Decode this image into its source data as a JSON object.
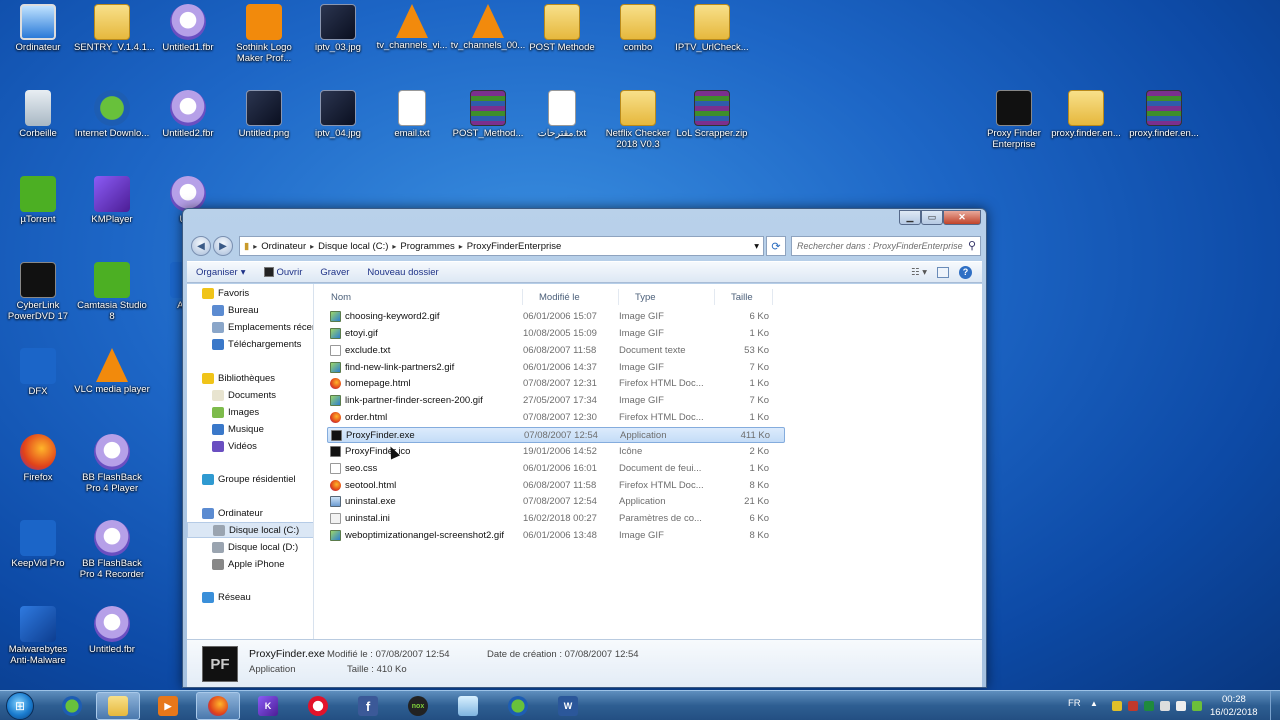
{
  "desktop": {
    "icons": [
      {
        "label": "Ordinateur",
        "icon": "computer-icon"
      },
      {
        "label": "SENTRY_V.1.4.1...",
        "icon": "folder-icon"
      },
      {
        "label": "Untitled1.fbr",
        "icon": "flashback-recording-icon"
      },
      {
        "label": "Sothink Logo Maker Prof...",
        "icon": "sothink-logo-maker-icon"
      },
      {
        "label": "iptv_03.jpg",
        "icon": "image-file-icon"
      },
      {
        "label": "tv_channels_vi...",
        "icon": "vlc-playlist-icon"
      },
      {
        "label": "tv_channels_00...",
        "icon": "vlc-playlist-icon"
      },
      {
        "label": "POST Methode",
        "icon": "folder-icon"
      },
      {
        "label": "combo",
        "icon": "folder-icon"
      },
      {
        "label": "IPTV_UrlCheck...",
        "icon": "folder-icon"
      },
      {
        "label": "Corbeille",
        "icon": "recycle-bin-icon"
      },
      {
        "label": "Internet Downlo...",
        "icon": "internet-download-manager-icon"
      },
      {
        "label": "Untitled2.fbr",
        "icon": "flashback-recording-icon"
      },
      {
        "label": "Untitled.png",
        "icon": "image-file-icon"
      },
      {
        "label": "iptv_04.jpg",
        "icon": "image-file-icon"
      },
      {
        "label": "email.txt",
        "icon": "text-file-icon"
      },
      {
        "label": "POST_Method...",
        "icon": "archive-file-icon"
      },
      {
        "label": "مقترحات.txt",
        "icon": "text-file-icon"
      },
      {
        "label": "Netflix Checker 2018 V0.3",
        "icon": "folder-icon"
      },
      {
        "label": "LoL Scrapper.zip",
        "icon": "archive-file-icon"
      },
      {
        "label": "Proxy Finder Enterprise",
        "icon": "proxy-finder-icon"
      },
      {
        "label": "proxy.finder.en...",
        "icon": "folder-icon"
      },
      {
        "label": "proxy.finder.en...",
        "icon": "archive-file-icon"
      },
      {
        "label": "µTorrent",
        "icon": "utorrent-icon"
      },
      {
        "label": "KMPlayer",
        "icon": "kmplayer-icon"
      },
      {
        "label": "Unti",
        "icon": "flashback-recording-icon"
      },
      {
        "label": "CyberLink PowerDVD 17",
        "icon": "powerdvd-icon"
      },
      {
        "label": "Camtasia Studio 8",
        "icon": "camtasia-icon"
      },
      {
        "label": "AL M",
        "icon": "app-icon"
      },
      {
        "label": "DFX",
        "icon": "dfx-icon"
      },
      {
        "label": "VLC media player",
        "icon": "vlc-icon"
      },
      {
        "label": "Firefox",
        "icon": "firefox-icon"
      },
      {
        "label": "BB FlashBack Pro 4 Player",
        "icon": "flashback-player-icon"
      },
      {
        "label": "KeepVid Pro",
        "icon": "keepvid-icon"
      },
      {
        "label": "BB FlashBack Pro 4 Recorder",
        "icon": "flashback-recorder-icon"
      },
      {
        "label": "Malwarebytes Anti-Malware",
        "icon": "malwarebytes-icon"
      },
      {
        "label": "Untitled.fbr",
        "icon": "flashback-recording-icon"
      }
    ]
  },
  "explorer": {
    "breadcrumb": [
      "Ordinateur",
      "Disque local (C:)",
      "Programmes",
      "ProxyFinderEnterprise"
    ],
    "search_placeholder": "Rechercher dans : ProxyFinderEnterprise",
    "toolbar": {
      "organize": "Organiser",
      "open": "Ouvrir",
      "burn": "Graver",
      "new_folder": "Nouveau dossier"
    },
    "nav": [
      {
        "label": "Favoris",
        "icon": "star-icon"
      },
      {
        "label": "Bureau",
        "icon": "desktop-icon"
      },
      {
        "label": "Emplacements récen",
        "icon": "recent-places-icon"
      },
      {
        "label": "Téléchargements",
        "icon": "downloads-icon"
      },
      {
        "label": "Bibliothèques",
        "icon": "libraries-icon"
      },
      {
        "label": "Documents",
        "icon": "documents-icon"
      },
      {
        "label": "Images",
        "icon": "pictures-icon"
      },
      {
        "label": "Musique",
        "icon": "music-icon"
      },
      {
        "label": "Vidéos",
        "icon": "videos-icon"
      },
      {
        "label": "Groupe résidentiel",
        "icon": "homegroup-icon"
      },
      {
        "label": "Ordinateur",
        "icon": "computer-icon"
      },
      {
        "label": "Disque local (C:)",
        "icon": "drive-icon"
      },
      {
        "label": "Disque local (D:)",
        "icon": "drive-icon"
      },
      {
        "label": "Apple iPhone",
        "icon": "iphone-icon"
      },
      {
        "label": "Réseau",
        "icon": "network-icon"
      }
    ],
    "columns": {
      "name": "Nom",
      "modified": "Modifié le",
      "type": "Type",
      "size": "Taille"
    },
    "files": [
      {
        "name": "choosing-keyword2.gif",
        "modified": "06/01/2006 15:07",
        "type": "Image GIF",
        "size": "6 Ko"
      },
      {
        "name": "etoyi.gif",
        "modified": "10/08/2005 15:09",
        "type": "Image GIF",
        "size": "1 Ko"
      },
      {
        "name": "exclude.txt",
        "modified": "06/08/2007 11:58",
        "type": "Document texte",
        "size": "53 Ko"
      },
      {
        "name": "find-new-link-partners2.gif",
        "modified": "06/01/2006 14:37",
        "type": "Image GIF",
        "size": "7 Ko"
      },
      {
        "name": "homepage.html",
        "modified": "07/08/2007 12:31",
        "type": "Firefox HTML Doc...",
        "size": "1 Ko"
      },
      {
        "name": "link-partner-finder-screen-200.gif",
        "modified": "27/05/2007 17:34",
        "type": "Image GIF",
        "size": "7 Ko"
      },
      {
        "name": "order.html",
        "modified": "07/08/2007 12:30",
        "type": "Firefox HTML Doc...",
        "size": "1 Ko"
      },
      {
        "name": "ProxyFinder.exe",
        "modified": "07/08/2007 12:54",
        "type": "Application",
        "size": "411 Ko"
      },
      {
        "name": "ProxyFinder.ico",
        "modified": "19/01/2006 14:52",
        "type": "Icône",
        "size": "2 Ko"
      },
      {
        "name": "seo.css",
        "modified": "06/01/2006 16:01",
        "type": "Document de feui...",
        "size": "1 Ko"
      },
      {
        "name": "seotool.html",
        "modified": "06/08/2007 11:58",
        "type": "Firefox HTML Doc...",
        "size": "8 Ko"
      },
      {
        "name": "uninstal.exe",
        "modified": "07/08/2007 12:54",
        "type": "Application",
        "size": "21 Ko"
      },
      {
        "name": "uninstal.ini",
        "modified": "16/02/2018 00:27",
        "type": "Paramètres de co...",
        "size": "6 Ko"
      },
      {
        "name": "weboptimizationangel-screenshot2.gif",
        "modified": "06/01/2006 13:48",
        "type": "Image GIF",
        "size": "8 Ko"
      }
    ],
    "details": {
      "name": "ProxyFinder.exe",
      "type": "Application",
      "modified_label": "Modifié le : 07/08/2007 12:54",
      "size_label": "Taille : 410 Ko",
      "created_label": "Date de création : 07/08/2007 12:54"
    }
  },
  "taskbar": {
    "language": "FR",
    "time": "00:28",
    "date": "16/02/2018"
  },
  "colors": {
    "selection": "#c4dcf7",
    "window_frame": "#b9d1ea",
    "taskbar": "#2e5e92"
  }
}
